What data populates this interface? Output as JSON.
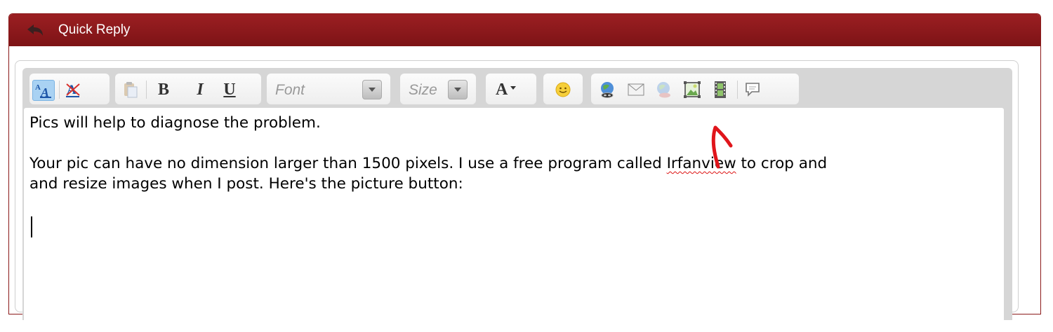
{
  "panel": {
    "title": "Quick Reply"
  },
  "editor": {
    "toolbar": {
      "font_placeholder": "Font",
      "size_placeholder": "Size",
      "bold_label": "B",
      "italic_label": "I",
      "underline_label": "U",
      "text_color_label": "A",
      "switch_mode_label": "A",
      "remove_format_label": "A"
    },
    "content": {
      "line1": "Pics will help to diagnose the problem.",
      "line2a": "Your pic can have no dimension larger than 1500 pixels. I use a free program called ",
      "spell_word": "Irfanview",
      "line2b": " to crop and",
      "line3": "and resize images when I post. Here's the picture button:"
    }
  },
  "colors": {
    "header": "#8b1a1a",
    "annotation": "#e0151b",
    "editor_bg": "#d6d6d6"
  },
  "icons": [
    "reply-arrow-icon",
    "switch-editor-mode-icon",
    "remove-format-icon",
    "paste-icon",
    "dropdown-arrow-icon",
    "smiley-icon",
    "link-icon",
    "email-icon",
    "unlink-icon",
    "image-icon",
    "video-icon",
    "quote-icon"
  ]
}
